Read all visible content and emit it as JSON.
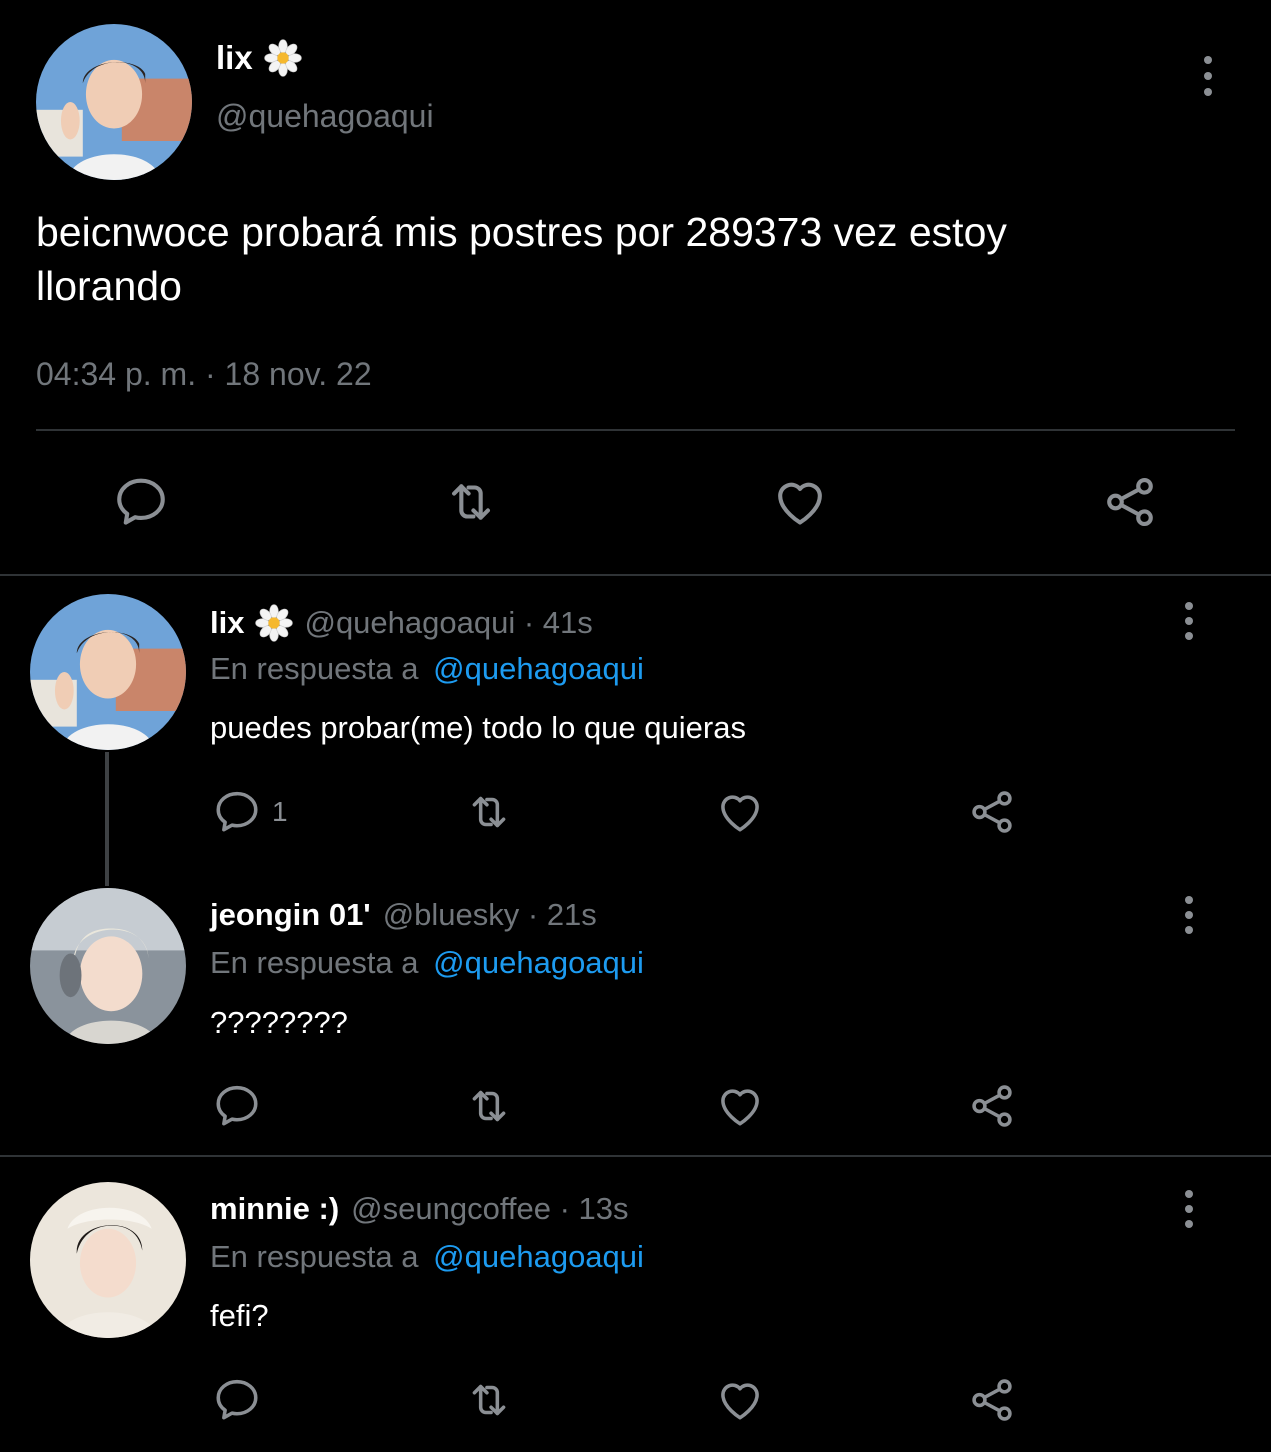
{
  "main_tweet": {
    "display_name": "lix",
    "handle": "@quehagoaqui",
    "text_line1": "beicnwoce probará mis postres por 289373 vez estoy",
    "text_line2": "llorando",
    "timestamp": "04:34 p. m. · 18 nov. 22",
    "actions": [
      "reply-icon",
      "retweet-icon",
      "like-icon",
      "share-icon"
    ]
  },
  "replies": [
    {
      "display_name": "lix",
      "handle_time": "@quehagoaqui · 41s",
      "reply_prefix": "En respuesta a",
      "reply_to": "@quehagoaqui",
      "text": "puedes probar(me) todo lo que quieras",
      "reply_count": "1"
    },
    {
      "display_name": "jeongin 01'",
      "handle_time": "@bluesky · 21s",
      "reply_prefix": "En respuesta a",
      "reply_to": "@quehagoaqui",
      "text": "????????",
      "reply_count": ""
    },
    {
      "display_name": "minnie :)",
      "handle_time": "@seungcoffee · 13s",
      "reply_prefix": "En respuesta a",
      "reply_to": "@quehagoaqui",
      "text": "fefi?",
      "reply_count": ""
    }
  ],
  "colors": {
    "background": "#000000",
    "muted": "#71767b",
    "link": "#1d9bf0",
    "divider": "#2f3336"
  }
}
